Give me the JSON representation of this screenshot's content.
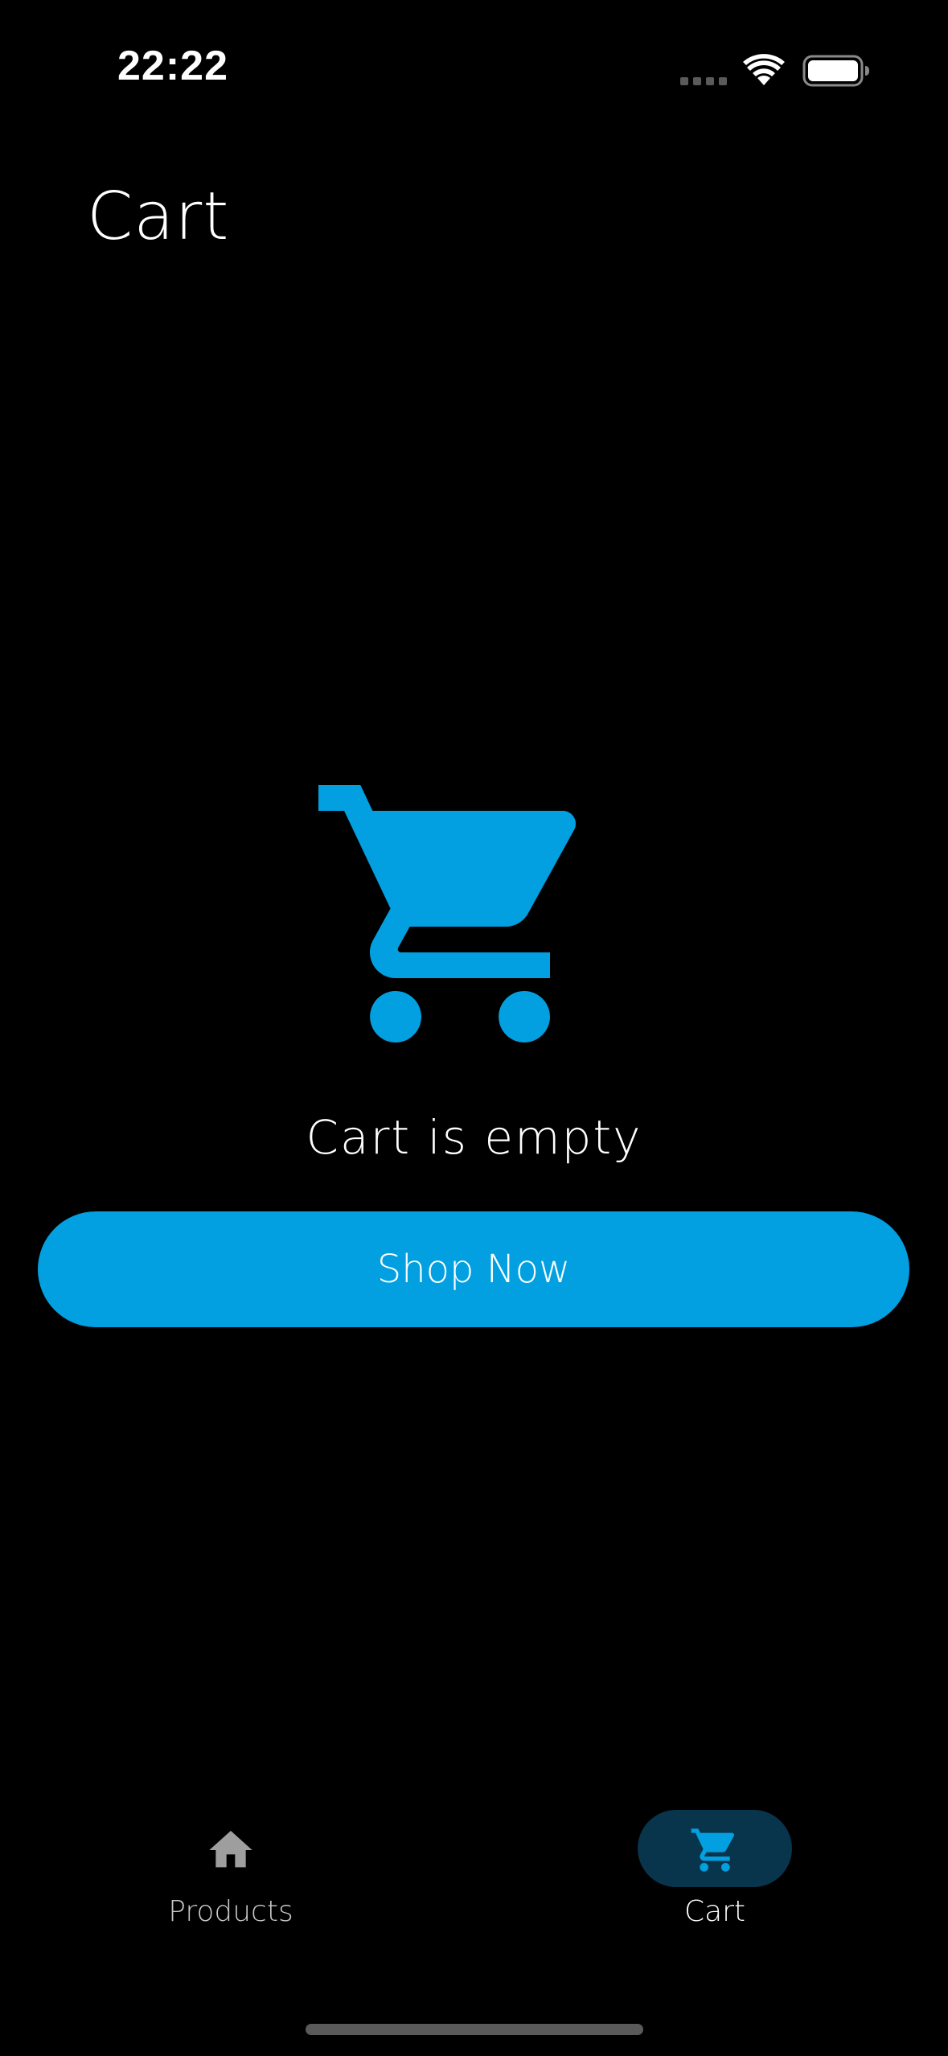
{
  "status_bar": {
    "time": "22:22",
    "icons": [
      "cellular-signal-icon",
      "wifi-icon",
      "battery-icon"
    ]
  },
  "header": {
    "title": "Cart"
  },
  "empty_state": {
    "icon": "shopping-cart-icon",
    "message": "Cart is empty",
    "button_label": "Shop Now"
  },
  "bottom_nav": {
    "items": [
      {
        "label": "Products",
        "icon": "home-icon",
        "selected": false
      },
      {
        "label": "Cart",
        "icon": "shopping-cart-icon",
        "selected": true
      }
    ]
  },
  "colors": {
    "background": "#000000",
    "accent": "#02a0e0",
    "nav_selected_pill": "#08354c",
    "text_primary": "#ffffff",
    "text_muted": "#c8c8c8"
  }
}
